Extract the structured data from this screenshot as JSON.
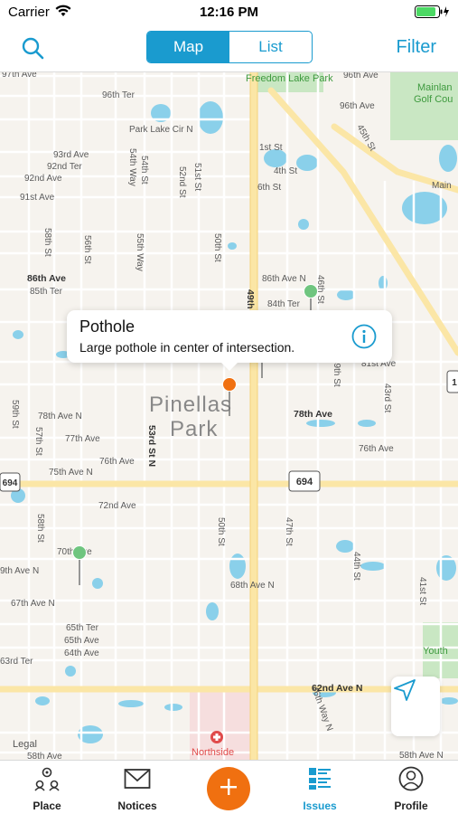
{
  "status": {
    "carrier": "Carrier",
    "time": "12:16 PM"
  },
  "nav": {
    "map_label": "Map",
    "list_label": "List",
    "filter_label": "Filter"
  },
  "map": {
    "callout": {
      "title": "Pothole",
      "description": "Large pothole in center of intersection."
    },
    "city": [
      "Pinellas",
      "Park"
    ],
    "legal": "Legal",
    "places": {
      "park": "Freedom Lake Park",
      "golf": [
        "Mainlan",
        "Golf Cou"
      ],
      "hospital": "Northside",
      "youth": "Youth"
    },
    "streets": {
      "s1": "97th Ave",
      "s2": "96th Ave",
      "s3": "96th Ter",
      "s4": "Park Lake Cir N",
      "s5": "93rd Ave",
      "s6": "92nd Ter",
      "s7": "92nd Ave",
      "s8": "91st Ave",
      "s9": "1st St",
      "s10": "4th St",
      "s11": "6th St",
      "s12": "45th St",
      "s13": "54th Way",
      "s14": "54th St",
      "s15": "51st St",
      "s16": "52nd St",
      "s17": "58th St",
      "s18": "56th St",
      "s19": "55th Way",
      "s20": "50th St",
      "s21": "86th Ave",
      "s22": "85th Ter",
      "s23": "86th Ave N",
      "s24": "84th Ter",
      "s25": "49th",
      "s26": "46th St",
      "s27": "81st Ave",
      "s28": "59th St",
      "s29": "78th Ave N",
      "s30": "77th Ave",
      "s31": "76th Ave",
      "s32": "75th Ave N",
      "s33": "53rd St N",
      "s34": "78th Ave",
      "s35": "76th Ave",
      "s36": "43rd St",
      "s37": "694",
      "s38": "72nd Ave",
      "s39": "58th St",
      "s40": "70th Ave",
      "s41": "9th Ave N",
      "s42": "67th Ave N",
      "s43": "50th St",
      "s44": "47th St",
      "s45": "68th Ave N",
      "s46": "44th St",
      "s47": "41st St",
      "s48": "65th Ter",
      "s49": "65th Ave",
      "s50": "64th Ave",
      "s51": "63rd Ter",
      "s52": "62nd Ave N",
      "s53": "46th Way N",
      "s54": "58th Ave",
      "s55": "58th Ave N",
      "s56": "Main",
      "s57": "96th Ave",
      "s58": "57th St",
      "s59": "49th St",
      "s60": "1"
    }
  },
  "tabs": [
    {
      "label": "Place"
    },
    {
      "label": "Notices"
    },
    {
      "label": "Issues"
    },
    {
      "label": "Profile"
    }
  ],
  "colors": {
    "accent": "#1a9bcf",
    "fab": "#f07010",
    "pin_active": "#f07010",
    "pin": "#6fc57f"
  }
}
